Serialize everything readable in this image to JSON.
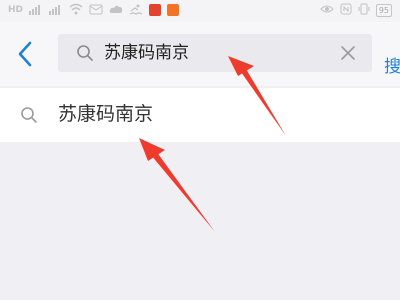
{
  "status_bar": {
    "left_label": "HD",
    "battery": "95"
  },
  "header": {
    "back_icon": "chevron-left-icon",
    "search": {
      "value": "苏康码南京",
      "icon": "search-icon",
      "clear_icon": "close-icon"
    },
    "action_label": "搜"
  },
  "suggestions": [
    {
      "label": "苏康码南京",
      "icon": "search-icon"
    }
  ],
  "colors": {
    "accent": "#1f80d8",
    "annotation_arrow": "#ef3b2c",
    "background": "#f0f0f4"
  }
}
